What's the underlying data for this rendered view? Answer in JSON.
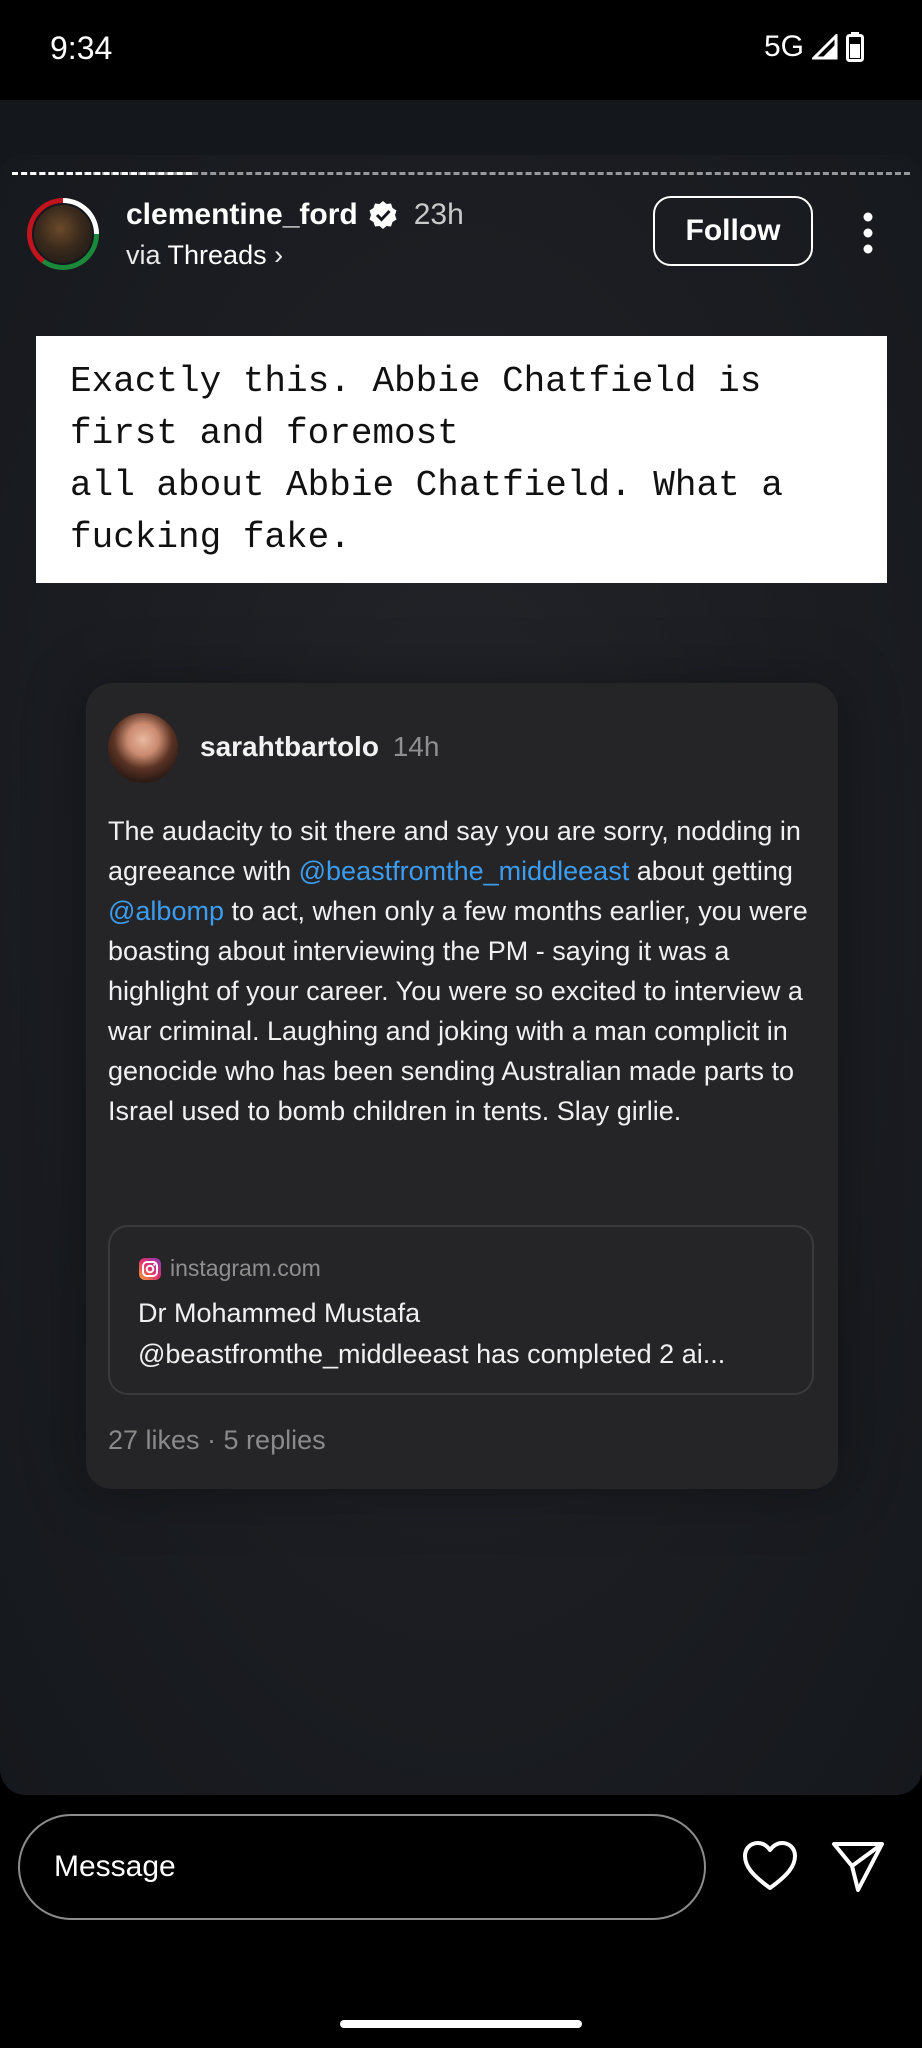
{
  "status_bar": {
    "time": "9:34",
    "network": "5G"
  },
  "story_header": {
    "username": "clementine_ford",
    "time": "23h",
    "via_prefix": "via",
    "via_app": "Threads",
    "via_chevron": "›",
    "follow_label": "Follow"
  },
  "caption": {
    "text": "Exactly this. Abbie Chatfield is\nfirst and foremost\nall about Abbie Chatfield. What a\nfucking fake."
  },
  "post": {
    "username": "sarahtbartolo",
    "time": "14h",
    "text_part1": "The audacity to sit there and say you are sorry, nodding in agreeance with ",
    "mention1": "@beastfromthe_middleeast",
    "text_part2": " about getting ",
    "mention2": "@albomp",
    "text_part3": " to act, when only a few months earlier, you were boasting about interviewing the PM - saying it was a highlight of your career. You were so excited to interview a war criminal. Laughing and joking with a man complicit in genocide who has been sending Australian made parts to Israel used to bomb children in tents. Slay girlie.",
    "link_card": {
      "domain": "instagram.com",
      "title": "Dr Mohammed Mustafa",
      "subtitle": "@beastfromthe_middleeast has completed 2 ai..."
    },
    "stats": "27 likes · 5 replies"
  },
  "bottom": {
    "message_placeholder": "Message"
  },
  "icons": {
    "verified": "verified-badge-icon",
    "more": "more-vertical-icon",
    "instagram": "instagram-icon",
    "like": "heart-icon",
    "send": "send-icon"
  },
  "colors": {
    "accent_link": "#3b9cf0",
    "background": "#14171c",
    "card": "#252527"
  }
}
